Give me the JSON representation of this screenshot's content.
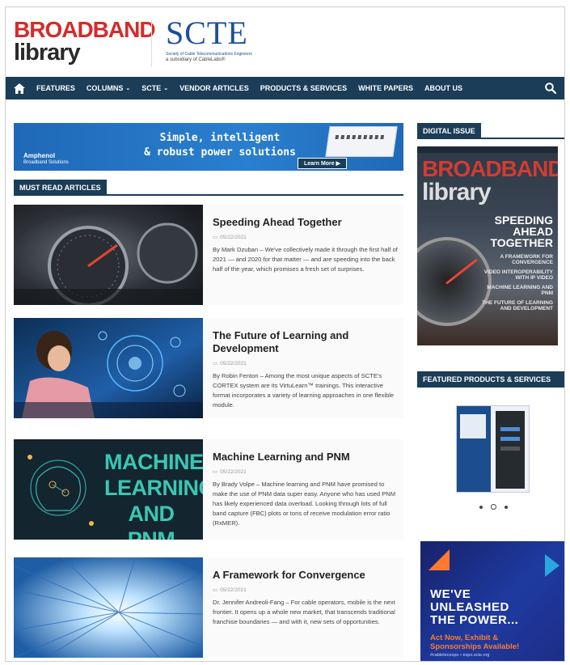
{
  "header": {
    "logo_line1": "BROADBAND",
    "logo_line2": "library",
    "partner_name": "SCTE",
    "partner_sub1": "Society of Cable Telecommunications Engineers",
    "partner_sub2": "a subsidiary of CableLabs®"
  },
  "nav": {
    "items": [
      "FEATURES",
      "COLUMNS",
      "SCTE",
      "VENDOR ARTICLES",
      "PRODUCTS & SERVICES",
      "WHITE PAPERS",
      "ABOUT US"
    ],
    "color": "#1b3d57"
  },
  "banner": {
    "brand": "Amphenol",
    "brand_sub": "Broadband Solutions",
    "headline_line1": "Simple, intelligent",
    "headline_line2": "& robust power solutions",
    "cta": "Learn More ▶"
  },
  "must_read": {
    "heading": "MUST READ ARTICLES",
    "articles": [
      {
        "title": "Speeding Ahead Together",
        "date": "05/22/2021",
        "excerpt": "By Mark Dzuban – We've collectively made it through the first half of 2021 — and 2020 for that matter — and are speeding into the back half of the year, which promises a fresh set of surprises."
      },
      {
        "title": "The Future of Learning and Development",
        "date": "05/22/2021",
        "excerpt": "By Robin Fenton – Among the most unique aspects of SCTE's CORTEX system are its VirtuLearn™ trainings. This interactive format incorporates a variety of learning approaches in one flexible module."
      },
      {
        "title": "Machine Learning and PNM",
        "date": "05/22/2021",
        "thumb_text": [
          "MACHINE",
          "LEARNING",
          "AND PNM"
        ],
        "excerpt": "By Brady Volpe – Machine learning and PNM have promised to make the use of PNM data super easy. Anyone who has used PNM has likely experienced data overload. Looking through lots of full band capture (FBC) plots or tons of receive modulation error ratio (RxMER)."
      },
      {
        "title": "A Framework for Convergence",
        "date": "05/22/2021",
        "excerpt": "Dr. Jennifer Andreoli-Fang – For cable operators, mobile is the next frontier. It opens up a whole new market, that transcends traditional franchise boundaries — and with it, new sets of opportunities."
      }
    ]
  },
  "sidebar": {
    "digital_issue_heading": "DIGITAL ISSUE",
    "cover": {
      "masthead1": "BROADBAND",
      "masthead2": "library",
      "headline": [
        "SPEEDING",
        "AHEAD",
        "TOGETHER"
      ],
      "toc": [
        "A FRAMEWORK FOR CONVERGENCE",
        "VIDEO INTEROPERABILITY WITH IP VIDEO",
        "MACHINE LEARNING AND PNM",
        "THE FUTURE OF LEARNING AND DEVELOPMENT"
      ]
    },
    "featured_heading": "FEATURED PRODUCTS & SERVICES",
    "expo_ad": {
      "headline": [
        "WE'VE",
        "UNLEASHED",
        "THE POWER..."
      ],
      "cta": [
        "Act Now, Exhibit &",
        "Sponsorships Available!"
      ],
      "tag": "#cabletecexpo • expo.scte.org"
    }
  }
}
